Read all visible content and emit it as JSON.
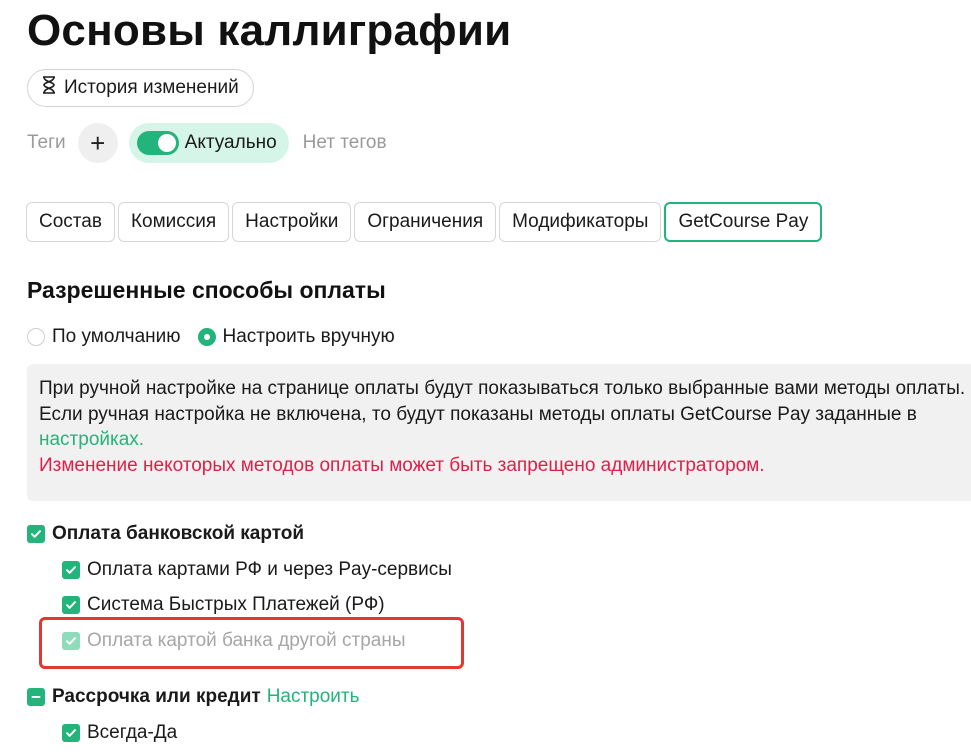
{
  "page": {
    "title": "Основы каллиграфии",
    "history_button": "История изменений",
    "tags_label": "Теги",
    "add_tag": "+",
    "status_toggle_label": "Актуально",
    "no_tags": "Нет тегов"
  },
  "tabs": [
    {
      "label": "Состав",
      "active": false
    },
    {
      "label": "Комиссия",
      "active": false
    },
    {
      "label": "Настройки",
      "active": false
    },
    {
      "label": "Ограничения",
      "active": false
    },
    {
      "label": "Модификаторы",
      "active": false
    },
    {
      "label": "GetCourse Pay",
      "active": true
    }
  ],
  "payment": {
    "section_title": "Разрешенные способы оплаты",
    "radio_default": "По умолчанию",
    "radio_manual": "Настроить вручную",
    "selected": "manual",
    "info_line1": "При ручной настройке на странице оплаты будут показываться только выбранные вами методы оплаты.",
    "info_line2": "Если ручная настройка не включена, то будут показаны методы оплаты GetCourse Pay заданные в",
    "info_link": "настройках.",
    "info_warning": "Изменение некоторых методов оплаты может быть запрещено администратором.",
    "bank_card": "Оплата банковской картой",
    "rf_cards": "Оплата картами РФ и через Pay-сервисы",
    "sbp": "Система Быстрых Платежей (РФ)",
    "foreign_card": "Оплата картой банка другой страны",
    "installment": "Рассрочка или кредит",
    "installment_link": "Настроить",
    "always_yes": "Всегда-Да"
  },
  "colors": {
    "accent": "#22b47a",
    "warning": "#e01e48",
    "highlight": "#e0392f"
  }
}
